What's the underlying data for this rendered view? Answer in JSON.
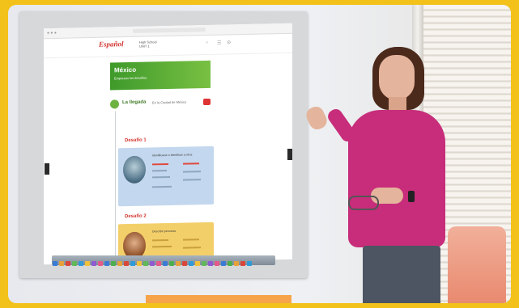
{
  "screen_content": {
    "site_logo": "Español",
    "header_line1": "High School",
    "header_line2": "UNIT 1",
    "banner_title": "México",
    "banner_subtitle": "Empiezan los desafíos",
    "lesson_label": "La llegada",
    "lesson_location": "En la Ciudad de México",
    "challenge_1_title": "Desafío 1",
    "challenge_2_title": "Desafío 2",
    "card1_heading": "Identificarse e identificar a otros",
    "card2_heading": "Describir personas"
  },
  "colors": {
    "frame_border": "#f2c21a",
    "banner_green": "#3e9a2a",
    "accent_red": "#d2322d",
    "card1_bg": "#c3d7ee",
    "card2_bg": "#f3cf6a",
    "shirt": "#c72d7a"
  }
}
